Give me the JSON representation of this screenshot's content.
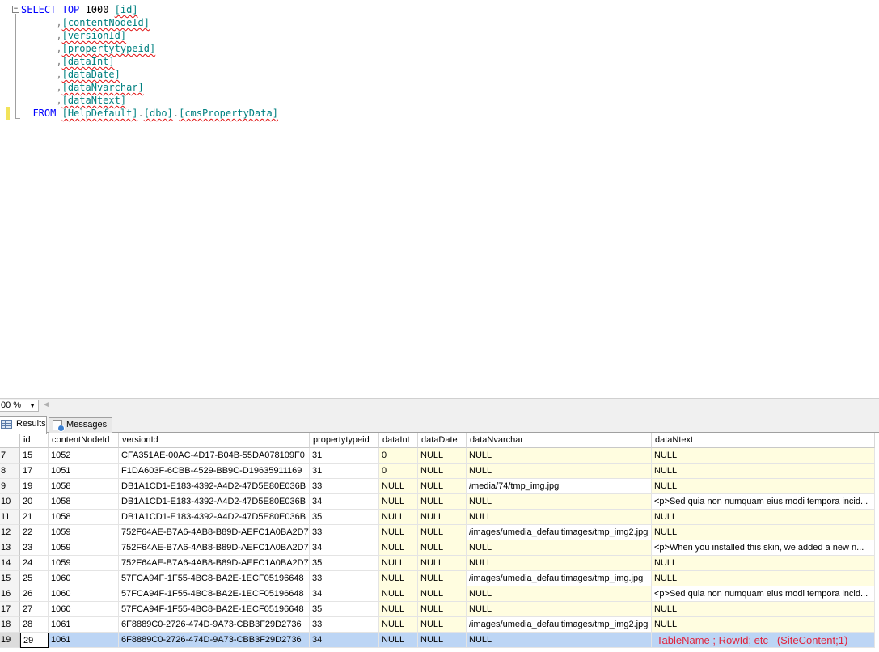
{
  "editor": {
    "collapse_glyph": "−",
    "select_kw": "SELECT",
    "top_kw": "TOP",
    "top_value": "1000",
    "col_prefix": ",",
    "columns": [
      "[id]",
      "[contentNodeId]",
      "[versionId]",
      "[propertytypeid]",
      "[dataInt]",
      "[dataDate]",
      "[dataNvarchar]",
      "[dataNtext]"
    ],
    "from_kw": "FROM",
    "from_db": "[HelpDefault]",
    "from_schema": "[dbo]",
    "from_table": "[cmsPropertyData]",
    "dot": "."
  },
  "zoom": {
    "value": "00 %",
    "arrow": "▼",
    "scroll_left": "◄"
  },
  "tabs": {
    "results": "Results",
    "messages": "Messages"
  },
  "grid": {
    "headers": [
      "",
      "id",
      "contentNodeId",
      "versionId",
      "propertytypeid",
      "dataInt",
      "dataDate",
      "dataNvarchar",
      "dataNtext"
    ],
    "rows": [
      [
        "7",
        "15",
        "1052",
        "CFA351AE-00AC-4D17-B04B-55DA078109F0",
        "31",
        "0",
        "NULL",
        "NULL",
        "NULL"
      ],
      [
        "8",
        "17",
        "1051",
        "F1DA603F-6CBB-4529-BB9C-D19635911169",
        "31",
        "0",
        "NULL",
        "NULL",
        "NULL"
      ],
      [
        "9",
        "19",
        "1058",
        "DB1A1CD1-E183-4392-A4D2-47D5E80E036B",
        "33",
        "NULL",
        "NULL",
        "/media/74/tmp_img.jpg",
        "NULL"
      ],
      [
        "10",
        "20",
        "1058",
        "DB1A1CD1-E183-4392-A4D2-47D5E80E036B",
        "34",
        "NULL",
        "NULL",
        "NULL",
        "<p>Sed quia non numquam eius modi tempora incid..."
      ],
      [
        "11",
        "21",
        "1058",
        "DB1A1CD1-E183-4392-A4D2-47D5E80E036B",
        "35",
        "NULL",
        "NULL",
        "NULL",
        "NULL"
      ],
      [
        "12",
        "22",
        "1059",
        "752F64AE-B7A6-4AB8-B89D-AEFC1A0BA2D7",
        "33",
        "NULL",
        "NULL",
        "/images/umedia_defaultimages/tmp_img2.jpg",
        "NULL"
      ],
      [
        "13",
        "23",
        "1059",
        "752F64AE-B7A6-4AB8-B89D-AEFC1A0BA2D7",
        "34",
        "NULL",
        "NULL",
        "NULL",
        "<p>When you installed this skin, we added a new n..."
      ],
      [
        "14",
        "24",
        "1059",
        "752F64AE-B7A6-4AB8-B89D-AEFC1A0BA2D7",
        "35",
        "NULL",
        "NULL",
        "NULL",
        "NULL"
      ],
      [
        "15",
        "25",
        "1060",
        "57FCA94F-1F55-4BC8-BA2E-1ECF05196648",
        "33",
        "NULL",
        "NULL",
        "/images/umedia_defaultimages/tmp_img.jpg",
        "NULL"
      ],
      [
        "16",
        "26",
        "1060",
        "57FCA94F-1F55-4BC8-BA2E-1ECF05196648",
        "34",
        "NULL",
        "NULL",
        "NULL",
        "<p>Sed quia non numquam eius modi tempora incid..."
      ],
      [
        "17",
        "27",
        "1060",
        "57FCA94F-1F55-4BC8-BA2E-1ECF05196648",
        "35",
        "NULL",
        "NULL",
        "NULL",
        "NULL"
      ],
      [
        "18",
        "28",
        "1061",
        "6F8889C0-2726-474D-9A73-CBB3F29D2736",
        "33",
        "NULL",
        "NULL",
        "/images/umedia_defaultimages/tmp_img2.jpg",
        "NULL"
      ],
      [
        "19",
        "29",
        "1061",
        "6F8889C0-2726-474D-9A73-CBB3F29D2736",
        "34",
        "NULL",
        "NULL",
        "NULL",
        ""
      ]
    ],
    "selected_row": 12,
    "annotation": "TableName ; RowId; etc   (SiteContent;1)"
  },
  "colors": {
    "keyword": "#0000ff",
    "identifier": "#008080",
    "null_cell_bg": "#fffde0",
    "selected_row_bg": "#bcd5f5",
    "annotation": "#e0243c"
  }
}
